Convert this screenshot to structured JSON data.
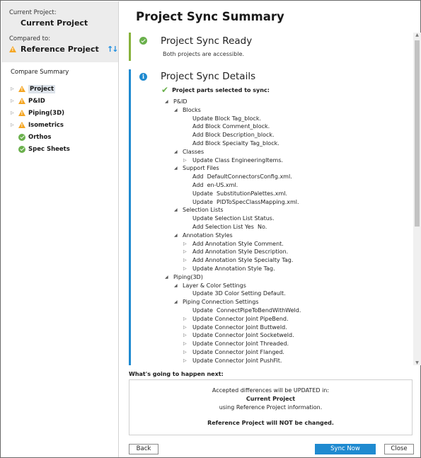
{
  "left": {
    "current_label": "Current Project:",
    "current_name": "Current Project",
    "compared_label": "Compared to:",
    "reference_name": "Reference Project",
    "summary_title": "Compare Summary",
    "items": [
      {
        "label": "Project",
        "status": "warning",
        "expandable": true,
        "selected": true
      },
      {
        "label": "P&ID",
        "status": "warning",
        "expandable": true,
        "selected": false
      },
      {
        "label": "Piping(3D)",
        "status": "warning",
        "expandable": true,
        "selected": false
      },
      {
        "label": "Isometrics",
        "status": "warning",
        "expandable": true,
        "selected": false
      },
      {
        "label": "Orthos",
        "status": "ok",
        "expandable": false,
        "selected": false
      },
      {
        "label": "Spec Sheets",
        "status": "ok",
        "expandable": false,
        "selected": false
      }
    ]
  },
  "main": {
    "title": "Project Sync Summary",
    "ready_title": "Project Sync Ready",
    "ready_sub": "Both projects are accessible.",
    "details_title": "Project Sync Details",
    "selected_label": "Project parts selected to sync:",
    "details": [
      {
        "t": "P&ID",
        "lv": 0,
        "tri": "down"
      },
      {
        "t": "Blocks",
        "lv": 1,
        "tri": "down"
      },
      {
        "t": "Update Block Tag_block.",
        "lv": 2,
        "tri": ""
      },
      {
        "t": "Add Block Comment_block.",
        "lv": 2,
        "tri": ""
      },
      {
        "t": "Add Block Description_block.",
        "lv": 2,
        "tri": ""
      },
      {
        "t": "Add Block Specialty Tag_block.",
        "lv": 2,
        "tri": ""
      },
      {
        "t": "Classes",
        "lv": 1,
        "tri": "down"
      },
      {
        "t": "Update Class EngineeringItems.",
        "lv": 2,
        "tri": "right"
      },
      {
        "t": "Support Files",
        "lv": 1,
        "tri": "down"
      },
      {
        "t": "Add  DefaultConnectorsConfig.xml.",
        "lv": 2,
        "tri": ""
      },
      {
        "t": "Add  en-US.xml.",
        "lv": 2,
        "tri": ""
      },
      {
        "t": "Update  SubstitutionPalettes.xml.",
        "lv": 2,
        "tri": ""
      },
      {
        "t": "Update  PIDToSpecClassMapping.xml.",
        "lv": 2,
        "tri": ""
      },
      {
        "t": "Selection Lists",
        "lv": 1,
        "tri": "down"
      },
      {
        "t": "Update Selection List Status.",
        "lv": 2,
        "tri": ""
      },
      {
        "t": "Add Selection List Yes  No.",
        "lv": 2,
        "tri": ""
      },
      {
        "t": "Annotation Styles",
        "lv": 1,
        "tri": "down"
      },
      {
        "t": "Add Annotation Style Comment.",
        "lv": 2,
        "tri": "right"
      },
      {
        "t": "Add Annotation Style Description.",
        "lv": 2,
        "tri": "right"
      },
      {
        "t": "Add Annotation Style Specialty Tag.",
        "lv": 2,
        "tri": "right"
      },
      {
        "t": "Update Annotation Style Tag.",
        "lv": 2,
        "tri": "right"
      },
      {
        "t": "Piping(3D)",
        "lv": 0,
        "tri": "down"
      },
      {
        "t": "Layer & Color Settings",
        "lv": 1,
        "tri": "down"
      },
      {
        "t": "Update 3D Color Setting Default.",
        "lv": 2,
        "tri": ""
      },
      {
        "t": "Piping Connection Settings",
        "lv": 1,
        "tri": "down"
      },
      {
        "t": "Update  ConnectPipeToBendWithWeld.",
        "lv": 2,
        "tri": ""
      },
      {
        "t": "Update Connector Joint PipeBend.",
        "lv": 2,
        "tri": "right"
      },
      {
        "t": "Update Connector Joint Buttweld.",
        "lv": 2,
        "tri": "right"
      },
      {
        "t": "Update Connector Joint Socketweld.",
        "lv": 2,
        "tri": "right"
      },
      {
        "t": "Update Connector Joint Threaded.",
        "lv": 2,
        "tri": "right"
      },
      {
        "t": "Update Connector Joint Flanged.",
        "lv": 2,
        "tri": "right"
      },
      {
        "t": "Update Connector Joint PushFit.",
        "lv": 2,
        "tri": "right"
      }
    ],
    "next_label": "What's going to happen next:",
    "next_line1": "Accepted differences will be UPDATED in:",
    "next_line2": "Current Project",
    "next_line3": "using Reference Project information.",
    "next_line4": "Reference Project will NOT be changed."
  },
  "buttons": {
    "back": "Back",
    "sync": "Sync Now",
    "close": "Close"
  },
  "colors": {
    "accent": "#1f8ad0",
    "ok": "#6ab04c",
    "warning": "#f5a623",
    "ready_bar": "#87b23c"
  }
}
